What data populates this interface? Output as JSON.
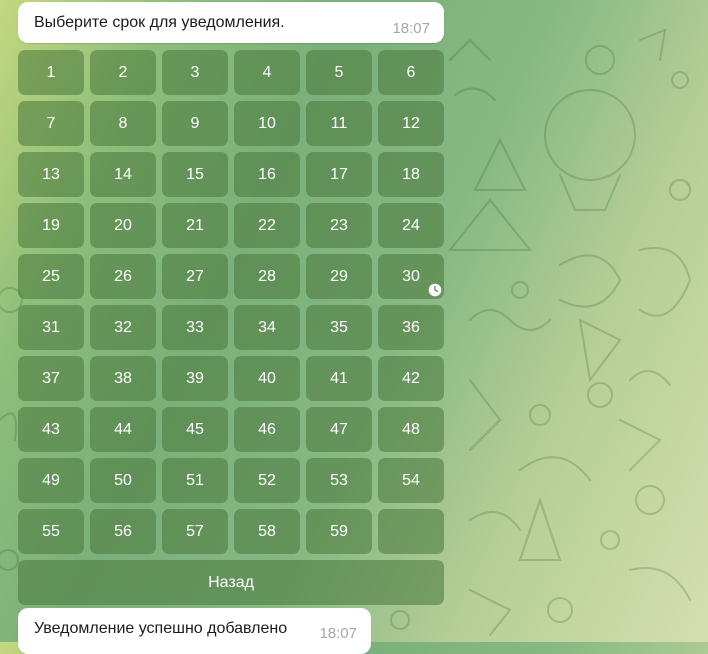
{
  "messages": [
    {
      "text": "Выберите срок для уведомления.",
      "time": "18:07"
    },
    {
      "text": "Уведомление успешно добавлено",
      "time": "18:07"
    }
  ],
  "keyboard": {
    "days": [
      "1",
      "2",
      "3",
      "4",
      "5",
      "6",
      "7",
      "8",
      "9",
      "10",
      "11",
      "12",
      "13",
      "14",
      "15",
      "16",
      "17",
      "18",
      "19",
      "20",
      "21",
      "22",
      "23",
      "24",
      "25",
      "26",
      "27",
      "28",
      "29",
      "30",
      "31",
      "32",
      "33",
      "34",
      "35",
      "36",
      "37",
      "38",
      "39",
      "40",
      "41",
      "42",
      "43",
      "44",
      "45",
      "46",
      "47",
      "48",
      "49",
      "50",
      "51",
      "52",
      "53",
      "54",
      "55",
      "56",
      "57",
      "58",
      "59",
      ""
    ],
    "back_label": "Назад"
  },
  "icons": {
    "pending": "clock-icon",
    "wallpaper": "doodle-pattern"
  },
  "colors": {
    "bubble": "#ffffff",
    "button": "#48763a",
    "time": "#a7a7a7"
  }
}
